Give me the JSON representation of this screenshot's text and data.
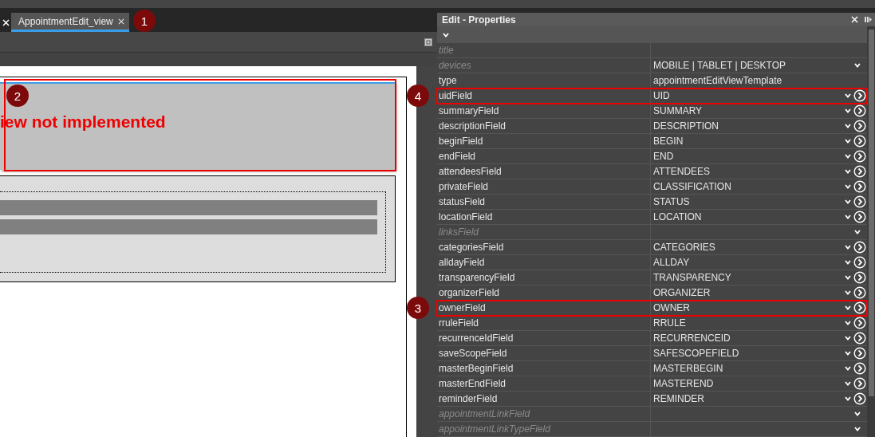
{
  "editor": {
    "tabs": [
      {
        "label": "AppointmentEdit_view",
        "selected": true,
        "callout": "1"
      }
    ],
    "preview": {
      "message": "iew not implemented",
      "callout": "2"
    }
  },
  "panel": {
    "title": "Edit - Properties",
    "properties": [
      {
        "name": "title",
        "kind": "text",
        "disabled": true
      },
      {
        "name": "devices",
        "value": "MOBILE | TABLET | DESKTOP",
        "kind": "select",
        "disabled": true
      },
      {
        "name": "type",
        "value": "appointmentEditViewTemplate",
        "kind": "text",
        "disabled": false
      },
      {
        "name": "uidField",
        "value": "UID",
        "kind": "link",
        "disabled": false,
        "highlighted": true,
        "callout": "4"
      },
      {
        "name": "summaryField",
        "value": "SUMMARY",
        "kind": "link",
        "disabled": false
      },
      {
        "name": "descriptionField",
        "value": "DESCRIPTION",
        "kind": "link",
        "disabled": false
      },
      {
        "name": "beginField",
        "value": "BEGIN",
        "kind": "link",
        "disabled": false
      },
      {
        "name": "endField",
        "value": "END",
        "kind": "link",
        "disabled": false
      },
      {
        "name": "attendeesField",
        "value": "ATTENDEES",
        "kind": "link",
        "disabled": false
      },
      {
        "name": "privateField",
        "value": "CLASSIFICATION",
        "kind": "link",
        "disabled": false
      },
      {
        "name": "statusField",
        "value": "STATUS",
        "kind": "link",
        "disabled": false
      },
      {
        "name": "locationField",
        "value": "LOCATION",
        "kind": "link",
        "disabled": false
      },
      {
        "name": "linksField",
        "kind": "select",
        "disabled": true
      },
      {
        "name": "categoriesField",
        "value": "CATEGORIES",
        "kind": "link",
        "disabled": false
      },
      {
        "name": "alldayField",
        "value": "ALLDAY",
        "kind": "link",
        "disabled": false
      },
      {
        "name": "transparencyField",
        "value": "TRANSPARENCY",
        "kind": "link",
        "disabled": false
      },
      {
        "name": "organizerField",
        "value": "ORGANIZER",
        "kind": "link",
        "disabled": false
      },
      {
        "name": "ownerField",
        "value": "OWNER",
        "kind": "link",
        "disabled": false,
        "highlighted": true,
        "callout": "3"
      },
      {
        "name": "rruleField",
        "value": "RRULE",
        "kind": "link",
        "disabled": false
      },
      {
        "name": "recurrenceIdField",
        "value": "RECURRENCEID",
        "kind": "link",
        "disabled": false
      },
      {
        "name": "saveScopeField",
        "value": "SAFESCOPEFIELD",
        "kind": "link",
        "disabled": false
      },
      {
        "name": "masterBeginField",
        "value": "MASTERBEGIN",
        "kind": "link",
        "disabled": false
      },
      {
        "name": "masterEndField",
        "value": "MASTEREND",
        "kind": "link",
        "disabled": false
      },
      {
        "name": "reminderField",
        "value": "REMINDER",
        "kind": "link",
        "disabled": false
      },
      {
        "name": "appointmentLinkField",
        "kind": "select",
        "disabled": true
      },
      {
        "name": "appointmentLinkTypeField",
        "kind": "select",
        "disabled": true
      }
    ]
  }
}
